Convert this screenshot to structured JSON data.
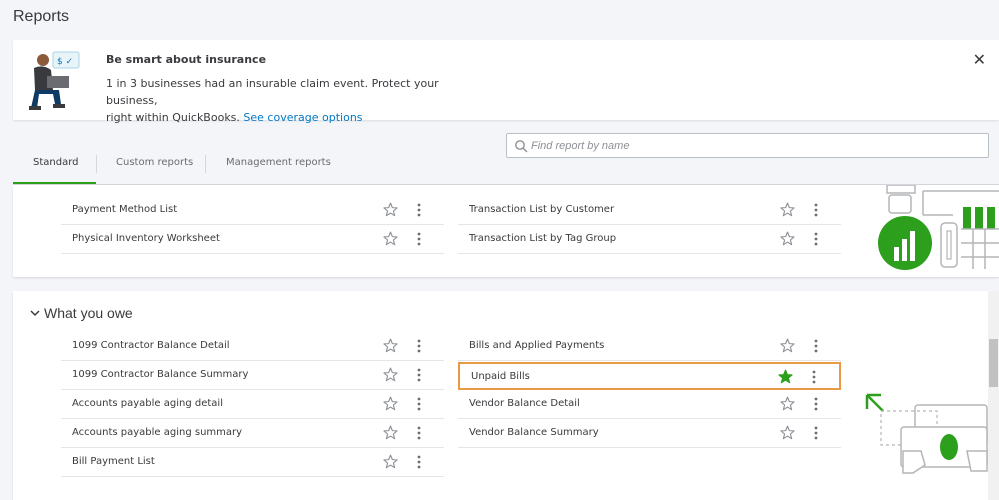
{
  "page": {
    "title": "Reports"
  },
  "banner": {
    "headline": "Be smart about insurance",
    "body_line1": "1 in 3 businesses had an insurable claim event. Protect your business,",
    "body_line2": "right within QuickBooks.",
    "link": "See coverage options",
    "close": "✕"
  },
  "search": {
    "placeholder": "Find report by name"
  },
  "tabs": [
    {
      "label": "Standard",
      "active": true
    },
    {
      "label": "Custom reports",
      "active": false
    },
    {
      "label": "Management reports",
      "active": false
    }
  ],
  "section_top": {
    "left": [
      "Payment Method List",
      "Physical Inventory Worksheet"
    ],
    "right": [
      "Transaction List by Customer",
      "Transaction List by Tag Group"
    ]
  },
  "section_owe": {
    "title": "What you owe",
    "left": [
      "1099 Contractor Balance Detail",
      "1099 Contractor Balance Summary",
      "Accounts payable aging detail",
      "Accounts payable aging summary",
      "Bill Payment List"
    ],
    "right": [
      "Bills and Applied Payments",
      "Unpaid Bills",
      "Vendor Balance Detail",
      "Vendor Balance Summary"
    ],
    "favorited": "Unpaid Bills"
  },
  "colors": {
    "accent": "#2ca01c",
    "link": "#0077c5",
    "highlight": "#e99a46",
    "text": "#393a3d",
    "star_empty": "#8d9096"
  }
}
